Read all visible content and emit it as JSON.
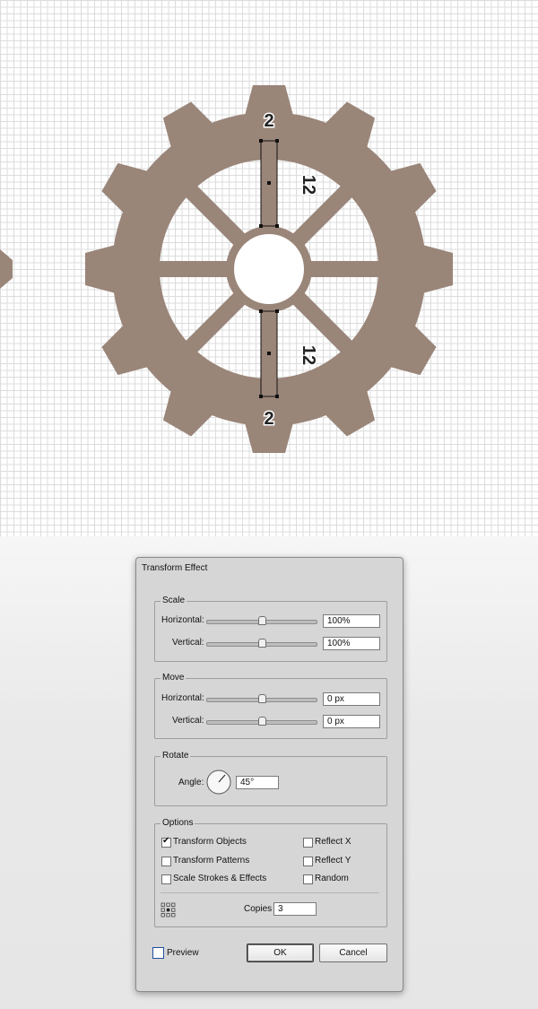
{
  "artwork": {
    "gear_color": "#9a8579",
    "dimension_labels": {
      "top_tooth": "2",
      "top_bar": "12",
      "bottom_bar": "12",
      "bottom_tooth": "2"
    }
  },
  "dialog": {
    "title": "Transform Effect",
    "scale": {
      "legend": "Scale",
      "horizontal_label": "Horizontal:",
      "horizontal_value": "100%",
      "vertical_label": "Vertical:",
      "vertical_value": "100%"
    },
    "move": {
      "legend": "Move",
      "horizontal_label": "Horizontal:",
      "horizontal_value": "0 px",
      "vertical_label": "Vertical:",
      "vertical_value": "0 px"
    },
    "rotate": {
      "legend": "Rotate",
      "angle_label": "Angle:",
      "angle_value": "45°"
    },
    "options": {
      "legend": "Options",
      "transform_objects": {
        "label": "Transform Objects",
        "checked": true
      },
      "transform_patterns": {
        "label": "Transform Patterns",
        "checked": false
      },
      "scale_strokes": {
        "label": "Scale Strokes & Effects",
        "checked": false
      },
      "reflect_x": {
        "label": "Reflect X",
        "checked": false
      },
      "reflect_y": {
        "label": "Reflect Y",
        "checked": false
      },
      "random": {
        "label": "Random",
        "checked": false
      },
      "copies_label": "Copies",
      "copies_value": "3"
    },
    "preview": {
      "label": "Preview",
      "checked": false
    },
    "ok_label": "OK",
    "cancel_label": "Cancel"
  }
}
